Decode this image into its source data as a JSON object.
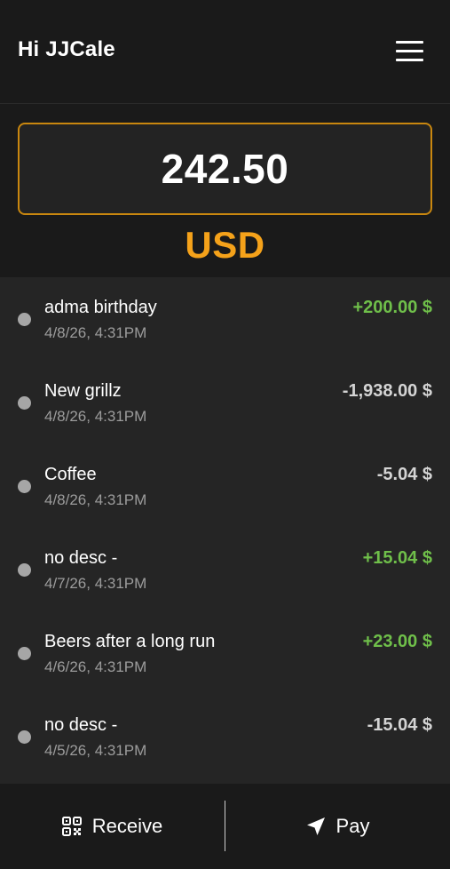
{
  "header": {
    "greeting": "Hi JJCale",
    "menu_icon": "hamburger-menu-icon"
  },
  "balance": {
    "amount": "242.50",
    "currency": "USD"
  },
  "colors": {
    "accent": "#f5a21a",
    "border": "#c9870f",
    "positive": "#6fbf4a",
    "negative": "#d4d4d4",
    "background": "#1a1a1a",
    "list_background": "#252525"
  },
  "transactions": [
    {
      "description": "adma birthday",
      "date": "4/8/26, 4:31PM",
      "amount": "+200.00 $",
      "type": "positive"
    },
    {
      "description": "New grillz",
      "date": "4/8/26, 4:31PM",
      "amount": "-1,938.00 $",
      "type": "negative"
    },
    {
      "description": "Coffee",
      "date": "4/8/26, 4:31PM",
      "amount": "-5.04 $",
      "type": "negative"
    },
    {
      "description": "no desc -",
      "date": "4/7/26, 4:31PM",
      "amount": "+15.04 $",
      "type": "positive"
    },
    {
      "description": "Beers after a long run",
      "date": "4/6/26, 4:31PM",
      "amount": "+23.00 $",
      "type": "positive"
    },
    {
      "description": "no desc -",
      "date": "4/5/26, 4:31PM",
      "amount": "-15.04 $",
      "type": "negative"
    }
  ],
  "footer": {
    "receive_label": "Receive",
    "receive_icon": "qr-code-icon",
    "pay_label": "Pay",
    "pay_icon": "send-arrow-icon"
  }
}
